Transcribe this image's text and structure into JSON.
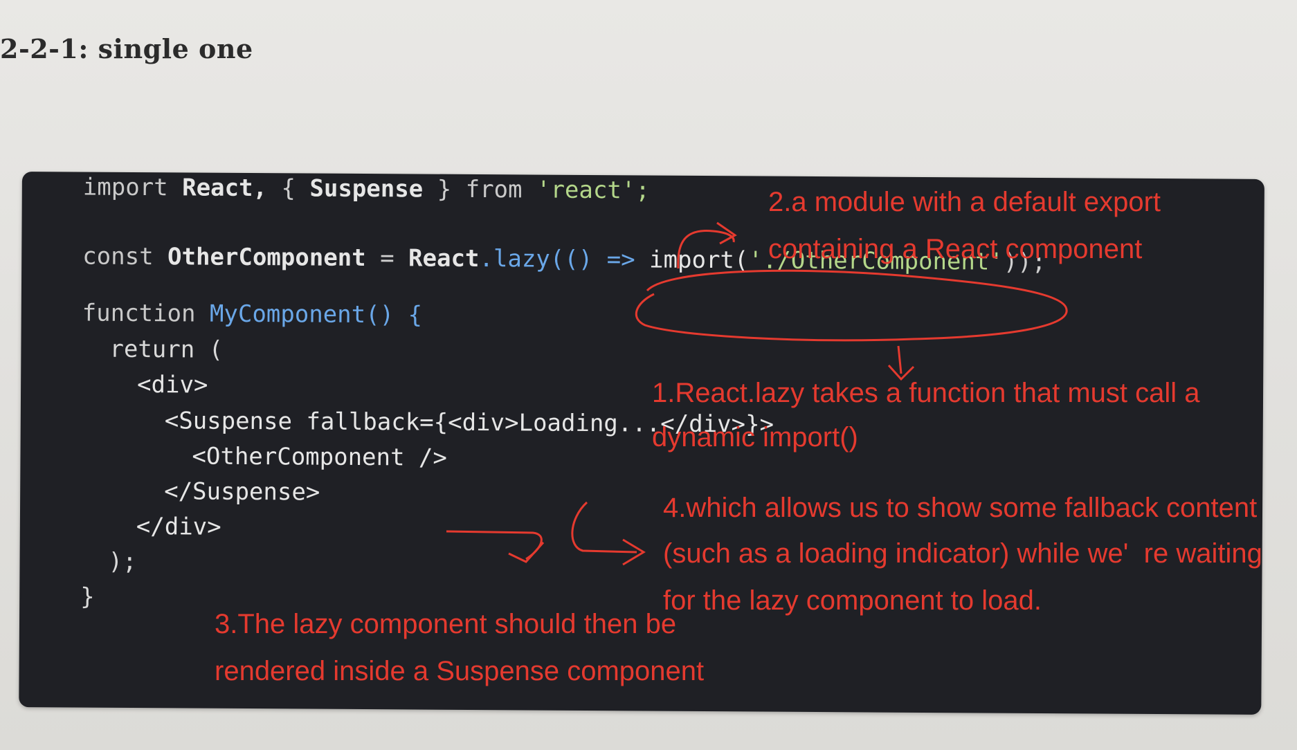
{
  "heading": "2-2-1:  single one",
  "code": {
    "import_kw": "import",
    "import_react": "React,",
    "import_brace_open": "{",
    "import_suspense": "Suspense",
    "import_brace_close": "}",
    "import_from": "from",
    "import_str": "'react';",
    "const_kw": "const",
    "const_name": "OtherComponent",
    "const_eq": "=",
    "const_react": "React",
    "const_lazy": ".lazy(() =>",
    "const_import": "import(",
    "const_path": "'./OtherComponent'",
    "const_close": "));",
    "fn_kw": "function",
    "fn_name": "MyComponent() {",
    "return_line": "return (",
    "div_open": "<div>",
    "suspense_open": "<Suspense fallback={<div>Loading...</div>}>",
    "other_component": "<OtherComponent />",
    "suspense_close": "</Suspense>",
    "div_close": "</div>",
    "paren_close": ");",
    "brace_close": "}"
  },
  "annotations": {
    "note1_line1": "1.React.lazy takes a function that must call a",
    "note1_line2": "dynamic import()",
    "note2_line1": "2.a module with a default export",
    "note2_line2": "containing a React component",
    "note3_line1": "3.The lazy component should then be",
    "note3_line2": "rendered inside a Suspense component",
    "note4_line1": "4.which allows us to show some fallback content",
    "note4_line2": "(such as a loading indicator) while we'  re waiting",
    "note4_line3": "for the lazy component to load."
  },
  "colors": {
    "code_background": "#1f2025",
    "annotation_red": "#e53a2f",
    "function_blue": "#6aa7e8",
    "string_green": "#b4d78a"
  }
}
